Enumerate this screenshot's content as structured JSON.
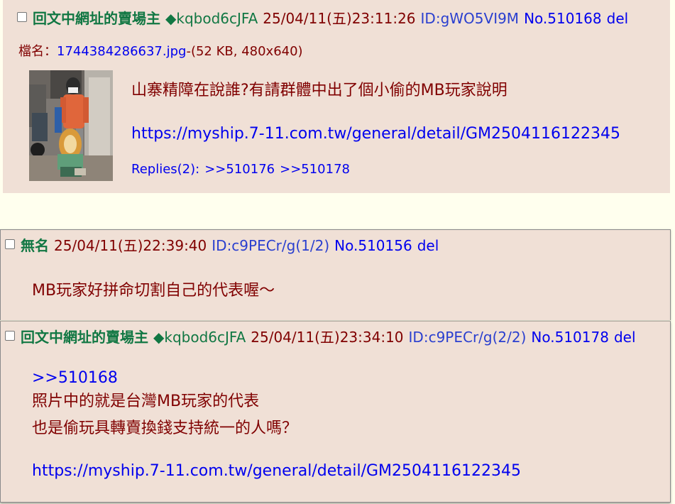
{
  "post1": {
    "name": "回文中網址的賣場主",
    "trip": "◆kqbod6cJFA",
    "datetime": "25/04/11(五)23:11:26",
    "id": "ID:gWO5VI9M",
    "no": "No.510168",
    "del": "del",
    "file_label": "檔名：",
    "file_name": "1744384286637.jpg",
    "file_meta": "-(52 KB, 480x640)",
    "text_line1": "山寨精障在說誰?有請群體中出了個小偷的MB玩家說明",
    "url": "https://myship.7-11.com.tw/general/detail/GM2504116122345",
    "replies_label": "Replies(2):",
    "reply1": ">>510176",
    "reply2": ">>510178"
  },
  "post2": {
    "name": "無名",
    "datetime": "25/04/11(五)22:39:40",
    "id": "ID:c9PECr/g(1/2)",
    "no": "No.510156",
    "del": "del",
    "text_line1": "MB玩家好拼命切割自己的代表喔～"
  },
  "post3": {
    "name": "回文中網址的賣場主",
    "trip": "◆kqbod6cJFA",
    "datetime": "25/04/11(五)23:34:10",
    "id": "ID:c9PECr/g(2/2)",
    "no": "No.510178",
    "del": "del",
    "quote": ">>510168",
    "text_line1": "照片中的就是台灣MB玩家的代表",
    "text_line2": "也是偷玩具轉賣換錢支持統一的人嗎？",
    "url": "https://myship.7-11.com.tw/general/detail/GM2504116122345"
  }
}
